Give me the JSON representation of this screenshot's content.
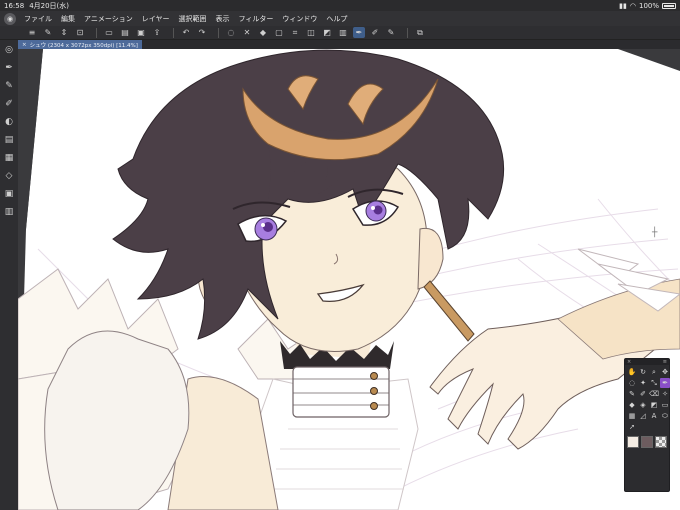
{
  "status_bar": {
    "time": "16:58",
    "date": "4月20日(水)",
    "battery": "100%"
  },
  "menu": {
    "items": [
      "ファイル",
      "編集",
      "アニメーション",
      "レイヤー",
      "選択範囲",
      "表示",
      "フィルター",
      "ウィンドウ",
      "ヘルプ"
    ]
  },
  "document_tab": {
    "label": "シュウ (2304 x 3072px 350dpi) [11.4%]"
  },
  "colors": {
    "accent": "#3f5e8a",
    "active_tool": "#8a4fc9",
    "hair": "#4b3f47",
    "skin": "#f9edd9",
    "eyes": "#a77ee0",
    "horn": "#d9a36d",
    "collar": "#2f2a2c"
  },
  "palette": {
    "main_color": "#f4ece3",
    "sub_color": "#6d5c5f",
    "close_label": "×",
    "menu_label": "≡"
  }
}
